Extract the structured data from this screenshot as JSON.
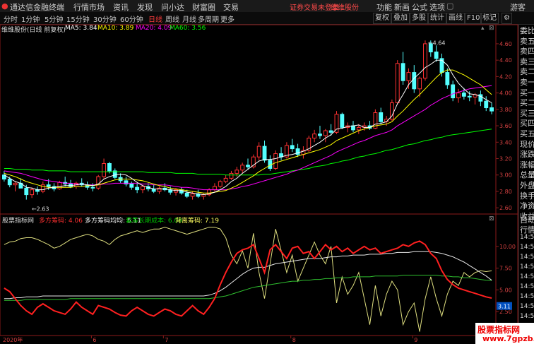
{
  "titlebar": {
    "app_title": "通达信金融终端",
    "menu": [
      "行情",
      "市场",
      "资讯",
      "发现",
      "问小达",
      "财富圈",
      "交易"
    ],
    "notice": "证券交易未登录",
    "notice2": "维维股份",
    "right_items": [
      "功能",
      "新画",
      "公式",
      "选项"
    ],
    "user": "游客"
  },
  "toolbar": {
    "periods": [
      "分时",
      "1分钟",
      "5分钟",
      "15分钟",
      "30分钟",
      "60分钟",
      "日线",
      "周线",
      "月线",
      "多周期",
      "更多"
    ],
    "active_period": "日线",
    "tools": [
      "复权",
      "叠加",
      "多股",
      "统计",
      "画线",
      "F10",
      "标记"
    ]
  },
  "main_chart": {
    "title": "维维股份(日线 前复权)",
    "ma_labels": [
      {
        "text": "MA5: 3.84",
        "color": "#ffffff"
      },
      {
        "text": "MA10: 3.89",
        "color": "#ffff00"
      },
      {
        "text": "MA20: 4.09",
        "color": "#ff00ff"
      },
      {
        "text": "MA60: 3.56",
        "color": "#00ff00"
      }
    ],
    "high_label": "4.64",
    "low_label": "2.63",
    "y_ticks": [
      "4.60",
      "4.40",
      "4.20",
      "4.00",
      "3.80",
      "3.60",
      "3.40",
      "3.20",
      "3.00",
      "2.80",
      "2.60"
    ]
  },
  "sub_chart": {
    "title": "股票指标网",
    "labels": [
      {
        "text": "多方筹码: 4.06",
        "color": "#ff3030"
      },
      {
        "text": "多方筹码均均: 6.11",
        "color": "#ffffff"
      },
      {
        "text": "套筹长期成本: 6.09",
        "color": "#00c000"
      },
      {
        "text": "背离筹码: 7.19",
        "color": "#ffff60"
      }
    ],
    "y_ticks": [
      "10.00",
      "7.50",
      "5.00",
      "2.50"
    ],
    "current_value": "3.11"
  },
  "x_axis": {
    "labels": [
      "2020年",
      "6",
      "7",
      "8",
      "9"
    ]
  },
  "side_panel": {
    "items": [
      "委比",
      "卖五",
      "卖四",
      "卖三",
      "卖二",
      "卖一",
      "买一",
      "买二",
      "买三",
      "买四",
      "买五",
      "现价",
      "涨跌",
      "涨幅",
      "总量",
      "外盘",
      "换手",
      "净资",
      "收益",
      "自动",
      "行情",
      "14:50",
      "14:50",
      "14:50",
      "14:50",
      "14:50",
      "14:50",
      "14:50",
      "14:50",
      "14:50",
      "14:50",
      "14:50"
    ]
  },
  "watermark": {
    "line1": "股票指标网",
    "line2": "www.7gpzb.com"
  },
  "chart_data": {
    "type": "candlestick",
    "price_range": [
      2.55,
      4.72
    ],
    "candles": [
      [
        3.0,
        3.05,
        2.92,
        2.95
      ],
      [
        2.95,
        2.98,
        2.85,
        2.88
      ],
      [
        2.88,
        2.92,
        2.8,
        2.9
      ],
      [
        2.9,
        2.96,
        2.86,
        2.84
      ],
      [
        2.84,
        2.88,
        2.7,
        2.76
      ],
      [
        2.76,
        2.85,
        2.72,
        2.82
      ],
      [
        2.82,
        2.86,
        2.76,
        2.8
      ],
      [
        2.8,
        2.92,
        2.78,
        2.88
      ],
      [
        2.88,
        2.95,
        2.82,
        2.86
      ],
      [
        2.86,
        2.9,
        2.8,
        2.83
      ],
      [
        2.83,
        2.93,
        2.82,
        2.91
      ],
      [
        2.91,
        2.98,
        2.86,
        2.89
      ],
      [
        2.89,
        2.94,
        2.84,
        2.86
      ],
      [
        2.86,
        2.92,
        2.83,
        2.9
      ],
      [
        2.9,
        2.96,
        2.86,
        2.88
      ],
      [
        2.88,
        2.92,
        2.82,
        2.85
      ],
      [
        2.85,
        2.9,
        2.8,
        2.84
      ],
      [
        2.84,
        3.0,
        2.82,
        2.98
      ],
      [
        2.98,
        3.2,
        2.95,
        3.14
      ],
      [
        3.14,
        3.16,
        3.02,
        3.05
      ],
      [
        3.05,
        3.08,
        2.95,
        2.97
      ],
      [
        2.97,
        3.02,
        2.9,
        2.93
      ],
      [
        2.93,
        2.98,
        2.86,
        2.89
      ],
      [
        2.89,
        2.92,
        2.82,
        2.85
      ],
      [
        2.85,
        2.9,
        2.78,
        2.82
      ],
      [
        2.82,
        2.88,
        2.78,
        2.86
      ],
      [
        2.86,
        2.9,
        2.8,
        2.83
      ],
      [
        2.83,
        2.88,
        2.78,
        2.8
      ],
      [
        2.8,
        2.86,
        2.77,
        2.84
      ],
      [
        2.84,
        2.9,
        2.8,
        2.82
      ],
      [
        2.82,
        2.86,
        2.76,
        2.79
      ],
      [
        2.79,
        2.84,
        2.75,
        2.82
      ],
      [
        2.82,
        2.85,
        2.76,
        2.78
      ],
      [
        2.78,
        2.82,
        2.72,
        2.74
      ],
      [
        2.74,
        2.8,
        2.7,
        2.77
      ],
      [
        2.77,
        2.82,
        2.72,
        2.74
      ],
      [
        2.74,
        2.78,
        2.7,
        2.76
      ],
      [
        2.76,
        2.84,
        2.74,
        2.82
      ],
      [
        2.82,
        2.9,
        2.8,
        2.86
      ],
      [
        2.86,
        2.94,
        2.84,
        2.92
      ],
      [
        2.92,
        3.0,
        2.9,
        2.96
      ],
      [
        2.96,
        3.05,
        2.94,
        3.02
      ],
      [
        3.02,
        3.1,
        2.98,
        3.06
      ],
      [
        3.06,
        3.15,
        3.02,
        3.12
      ],
      [
        3.12,
        3.2,
        3.06,
        3.1
      ],
      [
        3.1,
        3.25,
        3.08,
        3.22
      ],
      [
        3.22,
        3.4,
        3.18,
        3.35
      ],
      [
        3.35,
        3.42,
        3.15,
        3.18
      ],
      [
        3.18,
        3.24,
        3.05,
        3.08
      ],
      [
        3.08,
        3.3,
        3.06,
        3.26
      ],
      [
        3.26,
        3.34,
        3.18,
        3.22
      ],
      [
        3.22,
        3.4,
        3.2,
        3.36
      ],
      [
        3.36,
        3.44,
        3.28,
        3.32
      ],
      [
        3.32,
        3.38,
        3.22,
        3.25
      ],
      [
        3.25,
        3.35,
        3.2,
        3.3
      ],
      [
        3.3,
        3.48,
        3.28,
        3.45
      ],
      [
        3.45,
        3.55,
        3.4,
        3.5
      ],
      [
        3.5,
        3.6,
        3.44,
        3.48
      ],
      [
        3.48,
        3.56,
        3.4,
        3.54
      ],
      [
        3.54,
        3.62,
        3.48,
        3.52
      ],
      [
        3.52,
        3.78,
        3.5,
        3.74
      ],
      [
        3.74,
        3.76,
        3.56,
        3.58
      ],
      [
        3.58,
        3.64,
        3.52,
        3.6
      ],
      [
        3.6,
        3.66,
        3.52,
        3.55
      ],
      [
        3.55,
        3.62,
        3.5,
        3.58
      ],
      [
        3.58,
        3.64,
        3.54,
        3.6
      ],
      [
        3.6,
        3.66,
        3.55,
        3.57
      ],
      [
        3.57,
        3.8,
        3.56,
        3.76
      ],
      [
        3.76,
        3.82,
        3.62,
        3.65
      ],
      [
        3.65,
        3.72,
        3.6,
        3.68
      ],
      [
        3.68,
        3.92,
        3.66,
        3.88
      ],
      [
        3.88,
        4.4,
        3.86,
        4.36
      ],
      [
        4.36,
        4.5,
        4.1,
        4.15
      ],
      [
        4.15,
        4.3,
        4.05,
        4.25
      ],
      [
        4.25,
        4.34,
        4.0,
        4.05
      ],
      [
        4.05,
        4.2,
        3.95,
        4.18
      ],
      [
        4.18,
        4.64,
        4.15,
        4.6
      ],
      [
        4.6,
        4.64,
        4.44,
        4.5
      ],
      [
        4.5,
        4.58,
        4.38,
        4.42
      ],
      [
        4.42,
        4.48,
        4.2,
        4.25
      ],
      [
        4.25,
        4.3,
        4.05,
        4.1
      ],
      [
        4.1,
        4.15,
        3.9,
        3.94
      ],
      [
        3.94,
        4.05,
        3.88,
        4.0
      ],
      [
        4.0,
        4.06,
        3.92,
        3.96
      ],
      [
        3.96,
        4.02,
        3.9,
        3.95
      ],
      [
        3.95,
        4.0,
        3.86,
        3.98
      ],
      [
        3.98,
        4.03,
        3.84,
        3.9
      ],
      [
        3.9,
        3.96,
        3.78,
        3.82
      ],
      [
        3.82,
        3.88,
        3.74,
        3.78
      ]
    ],
    "ma5": [
      3.0,
      2.96,
      2.92,
      2.9,
      2.85,
      2.84,
      2.82,
      2.82,
      2.84,
      2.85,
      2.86,
      2.87,
      2.87,
      2.88,
      2.89,
      2.88,
      2.87,
      2.89,
      2.95,
      2.98,
      3.0,
      3.01,
      3.0,
      2.96,
      2.91,
      2.87,
      2.85,
      2.83,
      2.83,
      2.83,
      2.82,
      2.81,
      2.81,
      2.79,
      2.78,
      2.77,
      2.76,
      2.77,
      2.79,
      2.82,
      2.86,
      2.92,
      2.96,
      3.02,
      3.07,
      3.12,
      3.17,
      3.19,
      3.19,
      3.2,
      3.22,
      3.24,
      3.25,
      3.27,
      3.29,
      3.32,
      3.36,
      3.4,
      3.45,
      3.49,
      3.56,
      3.57,
      3.59,
      3.6,
      3.61,
      3.58,
      3.58,
      3.62,
      3.63,
      3.65,
      3.72,
      3.87,
      3.98,
      4.1,
      4.18,
      4.24,
      4.31,
      4.35,
      4.4,
      4.4,
      4.34,
      4.22,
      4.12,
      4.05,
      3.99,
      3.98,
      3.96,
      3.92,
      3.88
    ],
    "ma10": [
      3.02,
      3.0,
      2.98,
      2.95,
      2.92,
      2.9,
      2.88,
      2.86,
      2.85,
      2.85,
      2.85,
      2.85,
      2.85,
      2.86,
      2.86,
      2.87,
      2.87,
      2.88,
      2.9,
      2.92,
      2.94,
      2.95,
      2.95,
      2.95,
      2.94,
      2.93,
      2.91,
      2.89,
      2.87,
      2.86,
      2.84,
      2.83,
      2.82,
      2.81,
      2.8,
      2.79,
      2.78,
      2.78,
      2.79,
      2.8,
      2.81,
      2.84,
      2.87,
      2.91,
      2.95,
      2.99,
      3.04,
      3.08,
      3.12,
      3.15,
      3.17,
      3.19,
      3.21,
      3.23,
      3.25,
      3.27,
      3.29,
      3.31,
      3.34,
      3.37,
      3.42,
      3.45,
      3.48,
      3.51,
      3.54,
      3.56,
      3.58,
      3.6,
      3.61,
      3.62,
      3.65,
      3.72,
      3.78,
      3.85,
      3.92,
      3.98,
      4.05,
      4.12,
      4.19,
      4.25,
      4.28,
      4.28,
      4.25,
      4.22,
      4.18,
      4.14,
      4.1,
      4.04,
      3.98
    ],
    "ma20": [
      3.05,
      3.04,
      3.03,
      3.02,
      3.0,
      2.98,
      2.96,
      2.94,
      2.93,
      2.92,
      2.91,
      2.9,
      2.9,
      2.89,
      2.89,
      2.88,
      2.88,
      2.88,
      2.89,
      2.89,
      2.9,
      2.9,
      2.9,
      2.9,
      2.9,
      2.89,
      2.89,
      2.88,
      2.88,
      2.88,
      2.87,
      2.86,
      2.85,
      2.85,
      2.84,
      2.83,
      2.82,
      2.82,
      2.82,
      2.82,
      2.82,
      2.83,
      2.84,
      2.86,
      2.87,
      2.89,
      2.91,
      2.93,
      2.95,
      2.97,
      2.99,
      3.01,
      3.04,
      3.06,
      3.09,
      3.12,
      3.15,
      3.18,
      3.21,
      3.24,
      3.28,
      3.31,
      3.34,
      3.37,
      3.4,
      3.42,
      3.45,
      3.48,
      3.5,
      3.52,
      3.55,
      3.6,
      3.64,
      3.68,
      3.72,
      3.76,
      3.8,
      3.85,
      3.89,
      3.93,
      3.96,
      3.99,
      4.01,
      4.03,
      4.05,
      4.06,
      4.07,
      4.08,
      4.09
    ],
    "ma60": [
      3.08,
      3.08,
      3.07,
      3.07,
      3.07,
      3.06,
      3.06,
      3.06,
      3.05,
      3.05,
      3.05,
      3.05,
      3.04,
      3.04,
      3.04,
      3.04,
      3.04,
      3.04,
      3.04,
      3.04,
      3.04,
      3.04,
      3.04,
      3.04,
      3.04,
      3.04,
      3.03,
      3.03,
      3.03,
      3.03,
      3.03,
      3.02,
      3.02,
      3.02,
      3.02,
      3.01,
      3.01,
      3.01,
      3.01,
      3.01,
      3.0,
      3.0,
      3.0,
      3.0,
      3.0,
      3.0,
      3.0,
      3.01,
      3.01,
      3.02,
      3.03,
      3.04,
      3.05,
      3.06,
      3.07,
      3.08,
      3.1,
      3.11,
      3.12,
      3.14,
      3.15,
      3.17,
      3.18,
      3.2,
      3.22,
      3.23,
      3.25,
      3.26,
      3.28,
      3.3,
      3.31,
      3.33,
      3.35,
      3.37,
      3.38,
      3.4,
      3.42,
      3.43,
      3.45,
      3.46,
      3.48,
      3.49,
      3.5,
      3.51,
      3.52,
      3.53,
      3.54,
      3.55,
      3.56
    ],
    "sub_range": [
      0,
      12.5
    ],
    "red_line": [
      5.2,
      4.8,
      4.0,
      3.2,
      2.6,
      2.2,
      3.0,
      3.4,
      3.0,
      2.6,
      2.4,
      2.2,
      2.8,
      3.6,
      3.0,
      2.6,
      2.2,
      3.2,
      3.0,
      2.8,
      2.4,
      2.1,
      2.0,
      2.6,
      3.0,
      2.6,
      2.2,
      2.0,
      2.4,
      2.8,
      2.6,
      2.2,
      2.0,
      2.6,
      3.2,
      2.6,
      2.2,
      3.0,
      4.0,
      5.6,
      7.0,
      8.2,
      9.2,
      9.6,
      9.8,
      10.2,
      8.6,
      7.0,
      9.6,
      10.2,
      9.4,
      8.6,
      9.8,
      10.0,
      9.2,
      9.4,
      8.6,
      9.4,
      10.2,
      9.6,
      10.0,
      9.4,
      9.8,
      9.2,
      9.6,
      10.0,
      9.6,
      9.8,
      9.2,
      9.4,
      9.6,
      9.8,
      10.2,
      10.0,
      10.4,
      10.6,
      10.2,
      9.2,
      8.6,
      7.2,
      6.2,
      5.6,
      5.2,
      5.0,
      4.8,
      4.6,
      4.4,
      4.2,
      4.06
    ],
    "white_line": [
      4.0,
      4.0,
      4.1,
      4.1,
      4.2,
      4.2,
      4.2,
      4.3,
      4.3,
      4.3,
      4.3,
      4.3,
      4.3,
      4.3,
      4.3,
      4.3,
      4.3,
      4.3,
      4.3,
      4.3,
      4.3,
      4.3,
      4.3,
      4.3,
      4.3,
      4.3,
      4.3,
      4.3,
      4.3,
      4.3,
      4.3,
      4.3,
      4.3,
      4.3,
      4.3,
      4.3,
      4.3,
      4.4,
      4.6,
      4.9,
      5.3,
      5.8,
      6.3,
      6.8,
      7.2,
      7.5,
      7.6,
      7.6,
      7.8,
      8.0,
      8.1,
      8.2,
      8.3,
      8.4,
      8.5,
      8.6,
      8.6,
      8.6,
      8.7,
      8.8,
      8.8,
      8.9,
      8.9,
      9.0,
      9.0,
      9.0,
      9.1,
      9.1,
      9.1,
      9.2,
      9.2,
      9.3,
      9.3,
      9.3,
      9.4,
      9.4,
      9.4,
      9.4,
      9.3,
      9.2,
      9.0,
      8.8,
      8.5,
      8.2,
      7.8,
      7.4,
      7.0,
      6.6,
      6.11
    ],
    "green_line": [
      3.8,
      3.8,
      3.8,
      3.8,
      3.9,
      3.9,
      3.9,
      3.9,
      3.9,
      3.9,
      3.9,
      3.9,
      4.0,
      4.0,
      4.0,
      4.0,
      4.0,
      4.0,
      4.0,
      4.0,
      4.0,
      4.0,
      4.0,
      4.0,
      4.0,
      4.0,
      4.0,
      4.0,
      4.0,
      4.0,
      4.0,
      4.0,
      4.0,
      4.0,
      4.0,
      4.0,
      4.0,
      4.0,
      4.1,
      4.2,
      4.3,
      4.5,
      4.7,
      4.9,
      5.1,
      5.3,
      5.4,
      5.5,
      5.6,
      5.7,
      5.8,
      5.9,
      6.0,
      6.0,
      6.1,
      6.1,
      6.2,
      6.2,
      6.3,
      6.3,
      6.4,
      6.4,
      6.4,
      6.5,
      6.5,
      6.5,
      6.5,
      6.6,
      6.6,
      6.6,
      6.6,
      6.6,
      6.7,
      6.7,
      6.7,
      6.7,
      6.7,
      6.7,
      6.7,
      6.6,
      6.6,
      6.5,
      6.5,
      6.4,
      6.4,
      6.3,
      6.2,
      6.1,
      6.09
    ],
    "yellow_line": [
      10.2,
      10.5,
      10.6,
      10.9,
      11.0,
      11.0,
      10.8,
      10.5,
      10.2,
      9.8,
      10.0,
      10.4,
      10.8,
      11.0,
      11.2,
      11.4,
      11.2,
      10.8,
      10.6,
      10.2,
      10.8,
      11.2,
      11.4,
      11.6,
      11.8,
      11.6,
      11.8,
      12.0,
      12.0,
      12.2,
      12.0,
      11.8,
      11.6,
      11.4,
      11.6,
      11.8,
      12.0,
      12.2,
      12.2,
      12.0,
      11.0,
      9.0,
      8.0,
      9.5,
      7.5,
      11.5,
      7.0,
      4.0,
      8.0,
      12.0,
      9.5,
      7.0,
      9.0,
      6.0,
      7.5,
      9.0,
      10.5,
      9.0,
      8.0,
      10.0,
      3.5,
      6.5,
      4.5,
      5.5,
      7.0,
      4.0,
      1.0,
      5.5,
      2.0,
      4.5,
      6.0,
      5.0,
      1.0,
      2.5,
      3.5,
      0.2,
      4.0,
      6.5,
      4.0,
      2.0,
      4.5,
      6.0,
      5.5,
      7.0,
      6.5,
      7.0,
      7.2,
      7.1,
      7.19
    ]
  }
}
